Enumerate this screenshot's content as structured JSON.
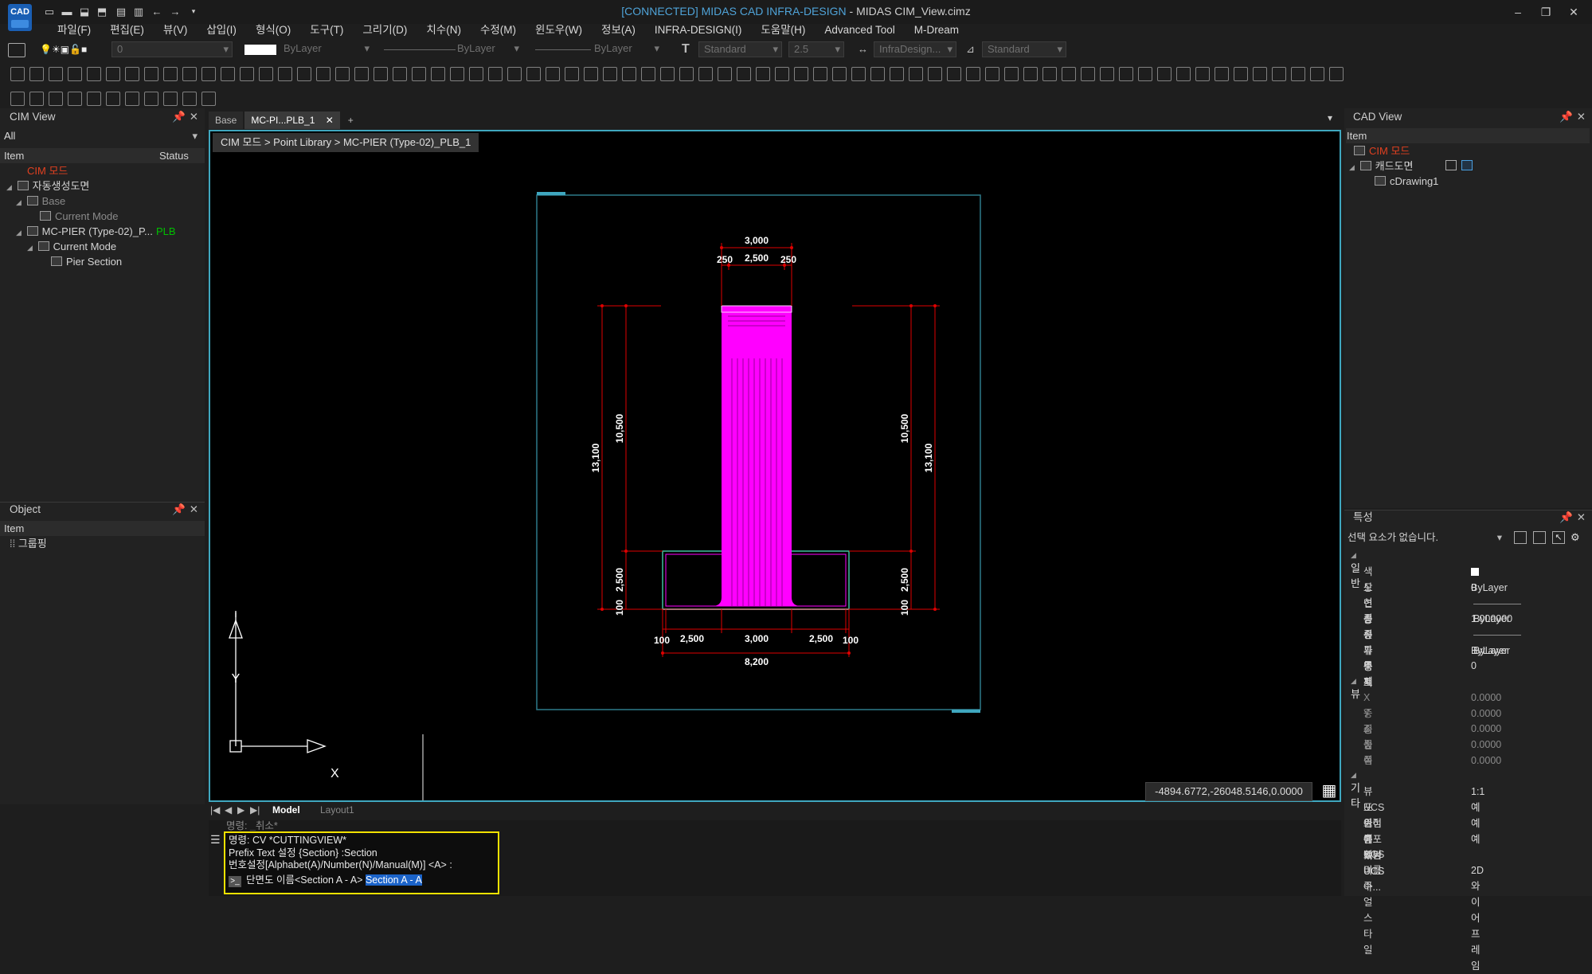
{
  "window": {
    "title_connected": "[CONNECTED] MIDAS CAD INFRA-DESIGN",
    "title_file": " - MIDAS CIM_View.cimz",
    "logo": "CAD"
  },
  "menu": [
    "파일(F)",
    "편집(E)",
    "뷰(V)",
    "삽입(I)",
    "형식(O)",
    "도구(T)",
    "그리기(D)",
    "치수(N)",
    "수정(M)",
    "윈도우(W)",
    "정보(A)",
    "INFRA-DESIGN(I)",
    "도움말(H)",
    "Advanced Tool",
    "M-Dream"
  ],
  "layer_combo": "0",
  "color_combo": "ByLayer",
  "linetype_combo": "ByLayer",
  "lineweight_combo": "ByLayer",
  "text_style": "Standard",
  "text_height": "2.5",
  "dim_style": "InfraDesign...",
  "table_style": "Standard",
  "cim_view": {
    "title": "CIM View",
    "filter": "All",
    "col_item": "Item",
    "col_status": "Status",
    "tree": {
      "root": "CIM 모드",
      "auto": "자동생성도면",
      "base": "Base",
      "base_mode": "Current Mode",
      "pier": "MC-PIER (Type-02)_P...",
      "pier_status": "PLB",
      "pier_mode": "Current Mode",
      "pier_section": "Pier Section"
    }
  },
  "object_panel": {
    "title": "Object",
    "col_item": "Item",
    "grouping": "그룹핑"
  },
  "tabs": [
    "Base",
    "MC-PI...PLB_1"
  ],
  "breadcrumb": "CIM 모드 > Point Library > MC-PIER (Type-02)_PLB_1",
  "drawing": {
    "dims_top": [
      "3,000",
      "250",
      "2,500",
      "250"
    ],
    "dims_left": [
      "13,100",
      "10,500",
      "2,500",
      "100"
    ],
    "dims_right": [
      "10,500",
      "13,100",
      "2,500",
      "100"
    ],
    "dims_bottom": [
      "100",
      "2,500",
      "3,000",
      "2,500",
      "100"
    ],
    "dim_total": "8,200",
    "axis_y": "Y",
    "axis_x": "X"
  },
  "coords": "-4894.6772,-26048.5146,0.0000",
  "model_tabs": [
    "Model",
    "Layout1"
  ],
  "command": {
    "hidden_line": "명령: _취소*",
    "lines": [
      "명령:  CV *CUTTINGVIEW*",
      "Prefix Text 설정 {Section} :Section",
      "번호설정[Alphabet(A)/Number(N)/Manual(M)] <A> :"
    ],
    "prompt": "단면도 이름<Section A - A>",
    "input": "Section A - A"
  },
  "cad_view": {
    "title": "CAD View",
    "col_item": "Item",
    "root": "CIM 모드",
    "child": "캐드도면",
    "drawing": "cDrawing1"
  },
  "properties": {
    "title": "특성",
    "selection": "선택 요소가 없습니다.",
    "sections": [
      {
        "name": "일반",
        "rows": [
          [
            "색상",
            "ByLayer"
          ],
          [
            "도면층",
            "0"
          ],
          [
            "선종류",
            "ByLayer"
          ],
          [
            "선종류 축척",
            "1.000000"
          ],
          [
            "선가중치",
            "ByLayer"
          ],
          [
            "투명도",
            "ByLayer"
          ],
          [
            "두께",
            "0"
          ]
        ]
      },
      {
        "name": "뷰",
        "rows": [
          [
            "X 중심",
            "0.0000"
          ],
          [
            "Y 중심",
            "0.0000"
          ],
          [
            "Z 중심",
            "0.0000"
          ],
          [
            "높이",
            "0.0000"
          ],
          [
            "폭",
            "0.0000"
          ]
        ]
      },
      {
        "name": "기타",
        "rows": [
          [
            "뷰포트 축척",
            "1:1"
          ],
          [
            "UCS 아이콘 켜기",
            "예"
          ],
          [
            "원점에 있는 UCS 아...",
            "예"
          ],
          [
            "뷰포트당 UCS",
            "예"
          ],
          [
            "UCS 이름",
            ""
          ],
          [
            "비주얼 스타일",
            "2D 와이어프레임"
          ]
        ]
      }
    ]
  },
  "colors": {
    "accent": "#3fa7bf",
    "pier": "#ff00ff",
    "dim": "#e00000",
    "highlight": "#f2e200",
    "status": "#00c000",
    "root": "#e04020"
  }
}
